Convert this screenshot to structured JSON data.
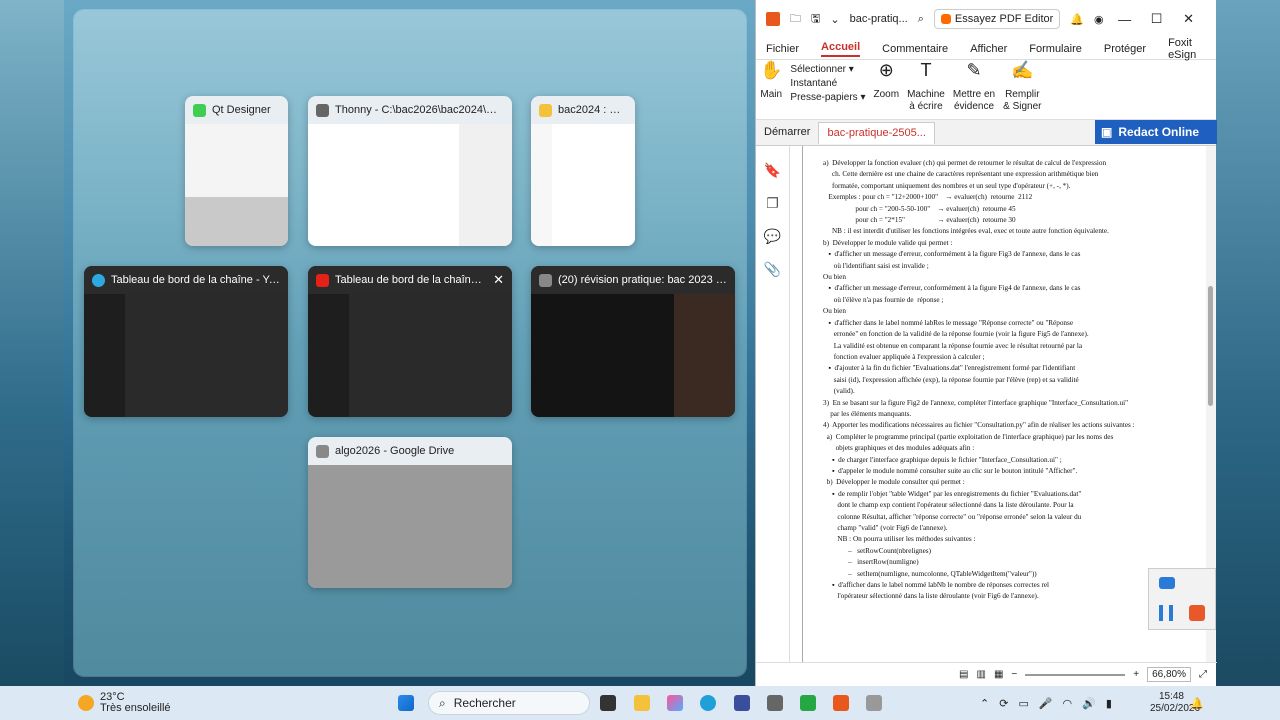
{
  "task_view": {
    "cards": [
      {
        "title": "Qt Designer",
        "dark": false,
        "close": ""
      },
      {
        "title": "Thonny  -  C:\\bac2026\\bac2024\\Consult...",
        "dark": false,
        "close": ""
      },
      {
        "title": "bac2024 : Expl...",
        "dark": false,
        "close": ""
      },
      {
        "title": "Tableau de bord de la chaîne - YouTube...",
        "dark": true,
        "close": ""
      },
      {
        "title": "Tableau de bord de la chaîne - Y...",
        "dark": true,
        "close": "✕"
      },
      {
        "title": "(20) révision pratique: bac 2023 - YouTu...",
        "dark": true,
        "close": ""
      },
      {
        "title": "algo2026 - Google Drive",
        "dark": false,
        "close": ""
      }
    ]
  },
  "pdf": {
    "file_name": "bac-pratiq...",
    "try_button": "Essayez PDF Editor",
    "menu": [
      "Fichier",
      "Accueil",
      "Commentaire",
      "Afficher",
      "Formulaire",
      "Protéger",
      "Foxit eSign"
    ],
    "ribbon": {
      "hand": "Main",
      "select": "Sélectionner",
      "snapshot": "Instantané",
      "clipboard": "Presse-papiers",
      "zoom": "Zoom",
      "typewriter": "Machine\nà écrire",
      "highlight": "Mettre en\névidence",
      "fill": "Remplir\n& Signer"
    },
    "tabs": [
      "Démarrer",
      "bac-pratique-2505..."
    ],
    "redact": "Redact Online",
    "zoom_value": "66,80%",
    "doc_lines": [
      "a)  Développer la fonction evaluer (ch) qui permet de retourner le résultat de calcul de l'expression",
      "     ch. Cette dernière est une chaine de caractères représentant une expression arithmétique bien",
      "     formatée, comportant uniquement des nombres et un seul type d'opérateur (+, -, *).",
      "   Exemples : pour ch = \"12+2000+100\"    → evaluer(ch)  retourne  2112",
      "                  pour ch = \"200-5-50-100\"    → evaluer(ch)  retourne 45",
      "                  pour ch = \"2*15\"                  → evaluer(ch)  retourne 30",
      "     NB : il est interdit d'utiliser les fonctions intégrées eval, exec et toute autre fonction équivalente.",
      "b)  Développer le module valide qui permet :",
      "   ▪  d'afficher un message d'erreur, conformément à la figure Fig3 de l'annexe, dans le cas",
      "      où l'identifiant saisi est invalide ;",
      "Ou bien",
      "   ▪  d'afficher un message d'erreur, conformément à la figure Fig4 de l'annexe, dans le cas",
      "      où l'élève n'a pas fournie de  réponse ;",
      "Ou bien",
      "   ▪  d'afficher dans le label nommé labRes le message \"Réponse correcte\" ou \"Réponse",
      "      erronée\" en fonction de la validité de la réponse fournie (voir la figure Fig5 de l'annexe).",
      "      La validité est obtenue en comparant la réponse fournie avec le résultat retourné par la",
      "      fonction evaluer appliquée à l'expression à calculer ;",
      "   ▪  d'ajouter à la fin du fichier \"Evaluations.dat\" l'enregistrement formé par l'identifiant",
      "      saisi (id), l'expression affichée (exp), la réponse fournie par l'élève (rep) et sa validité",
      "      (valid).",
      "3)  En se basant sur la figure Fig2 de l'annexe, compléter l'interface graphique \"Interface_Consultation.ui\"",
      "    par les éléments manquants.",
      "4)  Apporter les modifications nécessaires au fichier \"Consultation.py\" afin de réaliser les actions suivantes :",
      "  a)  Compléter le programme principal (partie exploitation de l'interface graphique) par les noms des",
      "       objets graphiques et des modules adéquats afin :",
      "     ▪  de charger l'interface graphique depuis le fichier \"Interface_Consultation.ui\" ;",
      "     ▪  d'appeler le module nommé consulter suite au clic sur le bouton intitulé \"Afficher\".",
      "  b)  Développer le module consulter qui permet :",
      "     ▪  de remplir l'objet \"table Widget\" par les enregistrements du fichier \"Evaluations.dat\"",
      "        dont le champ exp contient l'opérateur sélectionné dans la liste déroulante. Pour la",
      "        colonne Résultat, afficher \"réponse correcte\" ou \"réponse erronée\" selon la valeur du",
      "        champ \"valid\" (voir Fig6 de l'annexe).",
      "        NB : On pourra utiliser les méthodes suivantes :",
      "              –   setRowCount(nbrelignes)",
      "              –   insertRow(numligne)",
      "              –   setItem(numligne, numcolonne, QTableWidgetItem(\"valeur\"))",
      "     ▪  d'afficher dans le label nommé labNb le nombre de réponses correctes rel",
      "        l'opérateur sélectionné dans la liste déroulante (voir Fig6 de l'annexe)."
    ]
  },
  "taskbar": {
    "temp": "23°C",
    "weather": "Très ensoleillé",
    "search": "Rechercher",
    "time": "15:48",
    "date": "25/02/2026"
  }
}
